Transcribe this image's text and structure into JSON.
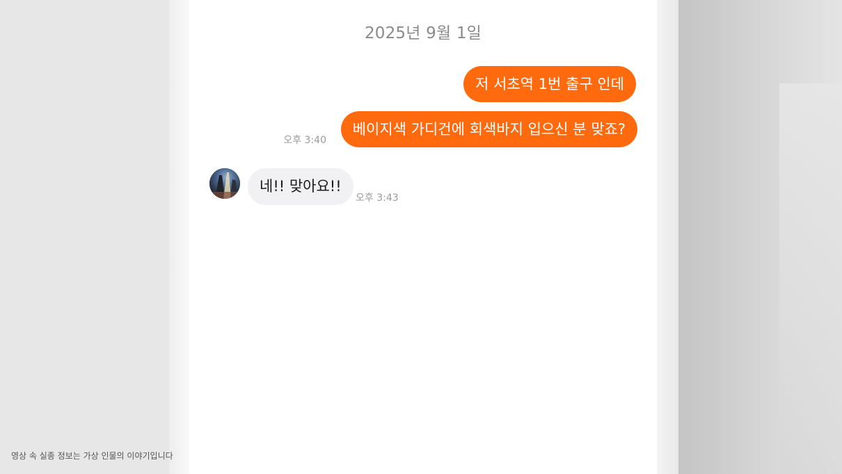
{
  "chat": {
    "date": "2025년 9월 1일",
    "messages": [
      {
        "direction": "outgoing",
        "text": "저 서초역 1번 출구 인데"
      },
      {
        "direction": "outgoing",
        "text": "베이지색 가디건에 회색바지 입으신 분 맞죠?",
        "time": "오후 3:40"
      },
      {
        "direction": "incoming",
        "text": "네!! 맞아요!!",
        "time": "오후 3:43"
      }
    ]
  },
  "caption": {
    "text": "영상 속 실종 정보는 가상 인물의 이야기입니다"
  },
  "colors": {
    "outgoing_bubble": "#ff6a0f",
    "incoming_bubble": "#f1f1f3",
    "background": "#e7e7e7"
  },
  "icons": {
    "avatar": "contact-avatar-photo"
  }
}
